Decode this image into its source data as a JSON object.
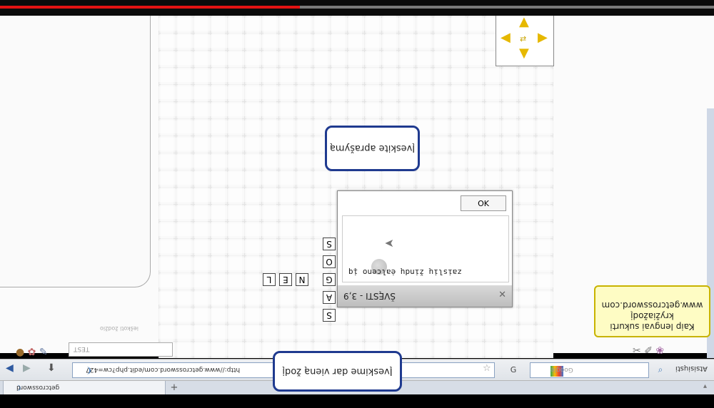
{
  "video": {
    "progress": 0.42
  },
  "dpad": {
    "up": "▲",
    "left": "◀",
    "right": "▶",
    "down": "▼",
    "center": "⇄"
  },
  "callouts": {
    "description": "Įveskite aprašymą",
    "word": "Įveskime dar vieną žodį",
    "promo_line1": "Kaip lengvai sukurti",
    "promo_line2": "kryžiažodį",
    "promo_line3": "www.getcrossword.com"
  },
  "dialog": {
    "ok": "OK",
    "typed": "zaislių žindų ėalceno įq",
    "title": "ŠVĘSTI - 3,9",
    "close": "✕"
  },
  "letters": {
    "col": [
      "S",
      "O",
      "G",
      "A",
      "S"
    ],
    "row": [
      "L",
      "E",
      "N"
    ]
  },
  "tools": {
    "search_placeholder": "TEST",
    "search_hint": "ieškoti žodžio"
  },
  "browser": {
    "url": "http://www.getcrossword.com/edit.php?cw=427",
    "search_placeholder": "Google",
    "menu": "Atsisiųsti",
    "tab_title": "getcrossword",
    "newtab": "+"
  },
  "colors": {
    "callout_border": "#1f3a8f",
    "promo_bg": "#fefcc4",
    "progress": "#e31313"
  }
}
